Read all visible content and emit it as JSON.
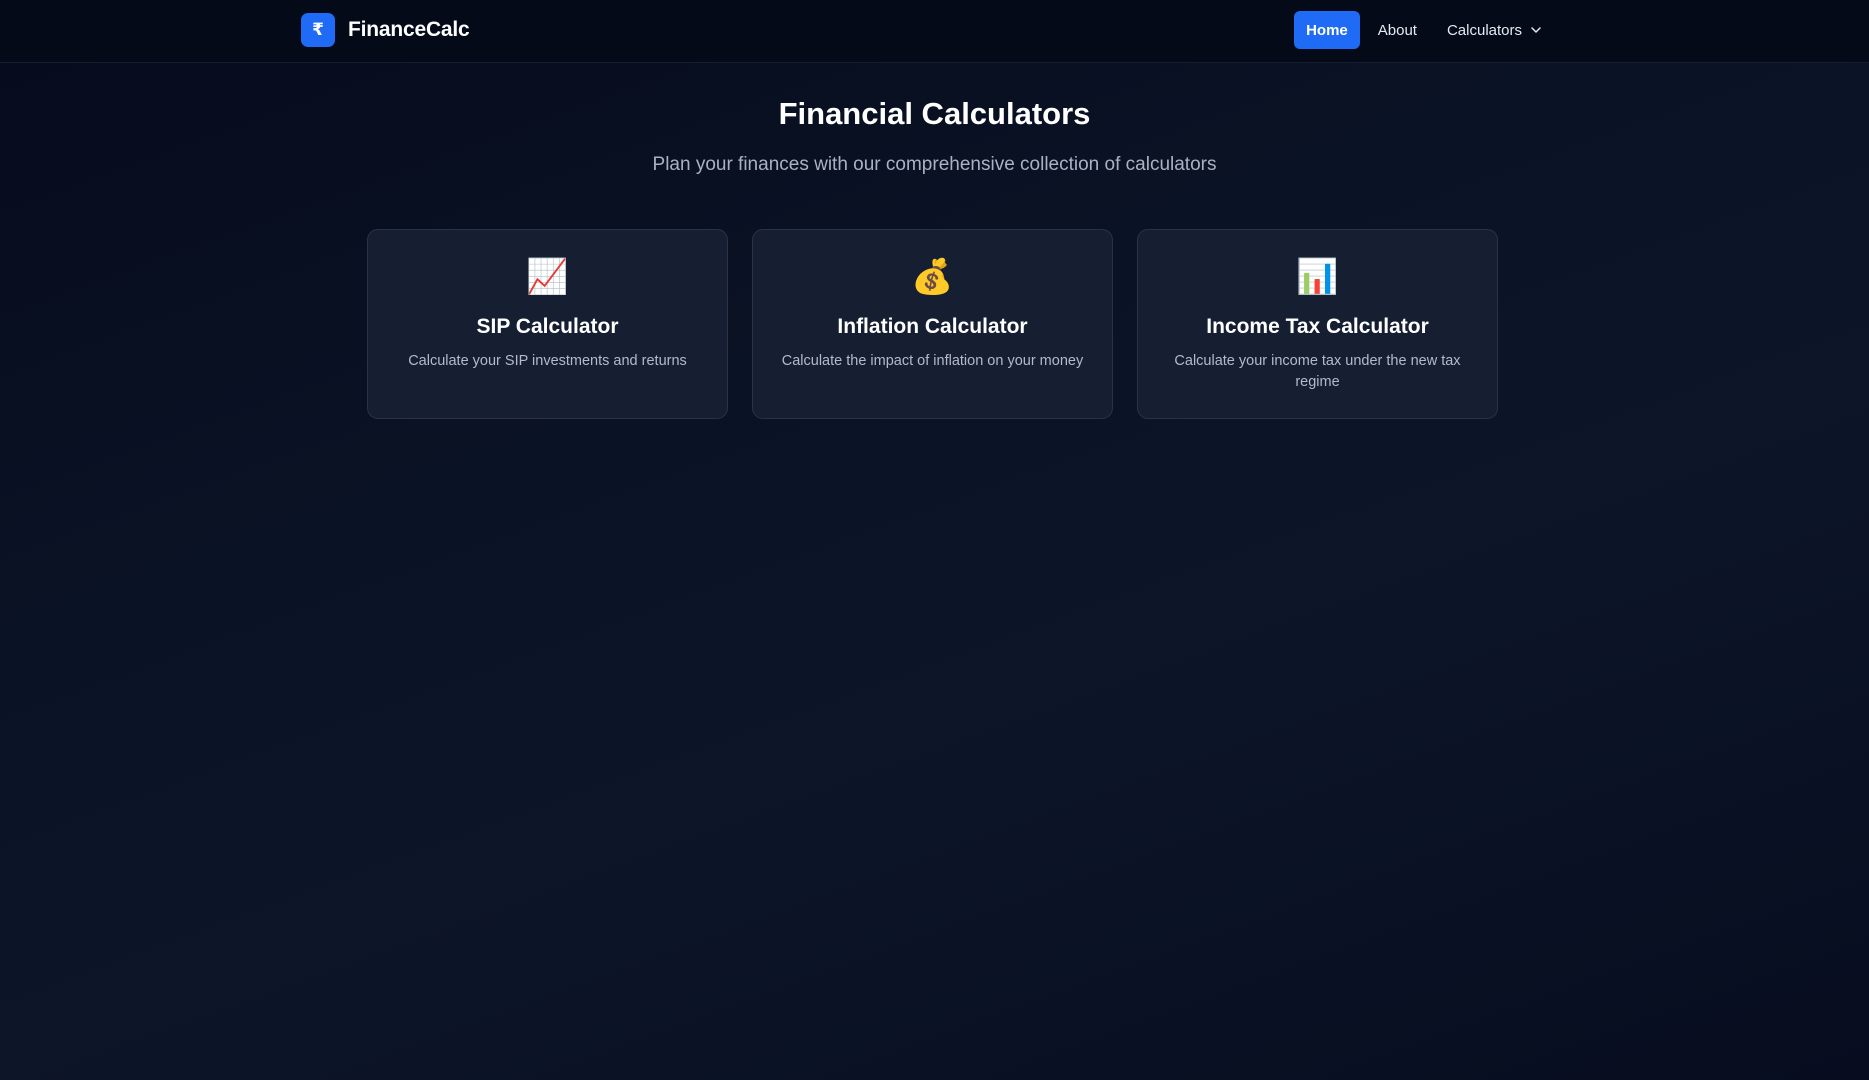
{
  "brand": {
    "logo_symbol": "₹",
    "name": "FinanceCalc"
  },
  "nav": {
    "home": "Home",
    "about": "About",
    "calculators": "Calculators"
  },
  "hero": {
    "title": "Financial Calculators",
    "subtitle": "Plan your finances with our comprehensive collection of calculators"
  },
  "cards": [
    {
      "icon": "chart-increasing-icon",
      "icon_glyph": "📈",
      "title": "SIP Calculator",
      "description": "Calculate your SIP investments and returns"
    },
    {
      "icon": "money-bag-icon",
      "icon_glyph": "💰",
      "title": "Inflation Calculator",
      "description": "Calculate the impact of inflation on your money"
    },
    {
      "icon": "bar-chart-icon",
      "icon_glyph": "📊",
      "title": "Income Tax Calculator",
      "description": "Calculate your income tax under the new tax regime"
    }
  ],
  "colors": {
    "accent": "#1f6bf5",
    "background": "#0b1427",
    "card": "#161e31"
  }
}
